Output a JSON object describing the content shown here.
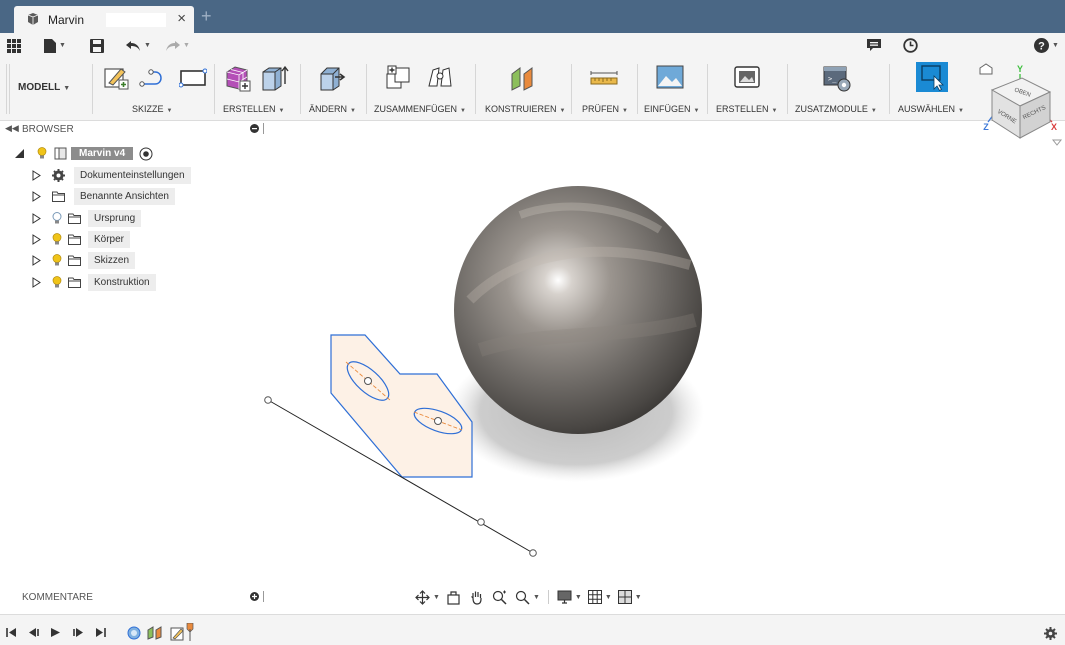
{
  "app": {
    "tab_title": "Marvin",
    "new_tab": "+"
  },
  "quick_access": {
    "icons": [
      "grid-icon",
      "file-icon",
      "save-icon",
      "undo-icon",
      "redo-icon",
      "notification-icon",
      "clock-icon",
      "help-icon"
    ]
  },
  "ribbon": {
    "workspace": "MODELL",
    "groups": [
      {
        "label": "SKIZZE"
      },
      {
        "label": "ERSTELLEN"
      },
      {
        "label": "ÄNDERN"
      },
      {
        "label": "ZUSAMMENFÜGEN"
      },
      {
        "label": "KONSTRUIEREN"
      },
      {
        "label": "PRÜFEN"
      },
      {
        "label": "EINFÜGEN"
      },
      {
        "label": "ERSTELLEN"
      },
      {
        "label": "ZUSATZMODULE"
      },
      {
        "label": "AUSWÄHLEN"
      }
    ]
  },
  "browser": {
    "title": "BROWSER",
    "root": "Marvin v4",
    "items": [
      {
        "label": "Dokumenteinstellungen",
        "icon": "gear-icon"
      },
      {
        "label": "Benannte Ansichten",
        "icon": "folder-icon"
      },
      {
        "label": "Ursprung",
        "icon": "folder-icon",
        "bulb": "off"
      },
      {
        "label": "Körper",
        "icon": "folder-icon",
        "bulb": "on"
      },
      {
        "label": "Skizzen",
        "icon": "folder-icon",
        "bulb": "on"
      },
      {
        "label": "Konstruktion",
        "icon": "folder-icon",
        "bulb": "on"
      }
    ]
  },
  "viewcube": {
    "top": "OBEN",
    "front": "VORNE",
    "right": "RECHTS",
    "axis_x": "X",
    "axis_y": "Y",
    "axis_z": "Z"
  },
  "comments": {
    "title": "KOMMENTARE"
  },
  "colors": {
    "titlebar": "#4a6785",
    "select_blue": "#1a8ad4",
    "sketch_blue": "#2f6fd6",
    "sketch_fill": "#fdf1e6"
  }
}
